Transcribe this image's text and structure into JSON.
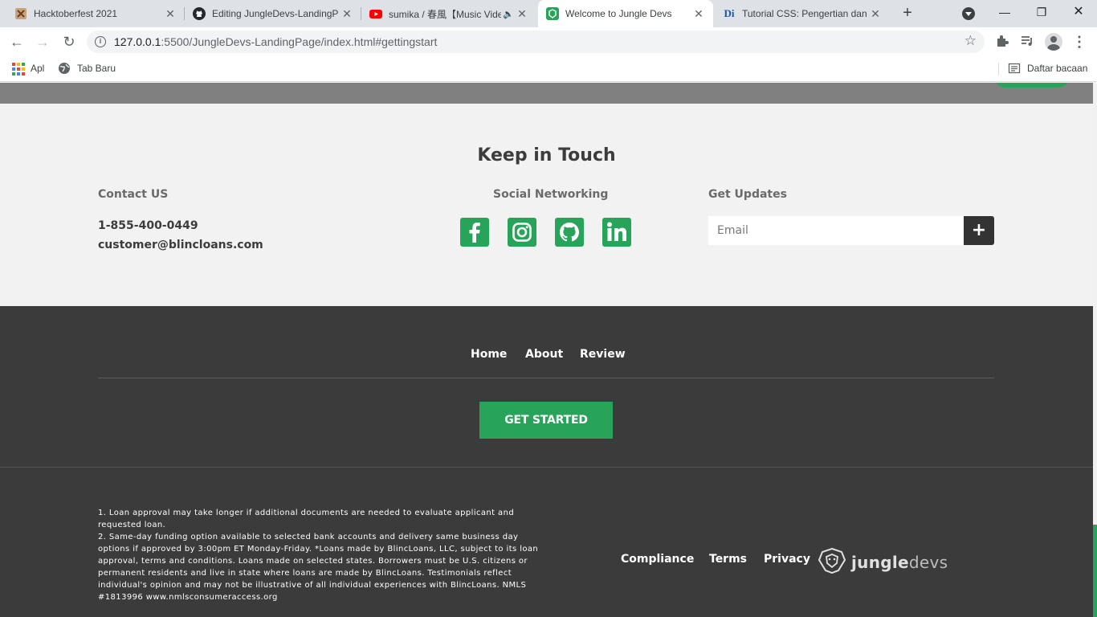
{
  "browser": {
    "tabs": [
      {
        "title": "Hacktoberfest 2021",
        "favicon": "hacktoberfest-icon"
      },
      {
        "title": "Editing JungleDevs-LandingP",
        "favicon": "github-icon"
      },
      {
        "title": "sumika / 春風【Music Vide",
        "favicon": "youtube-icon"
      },
      {
        "title": "Welcome to Jungle Devs",
        "favicon": "jungledevs-icon",
        "active": true
      },
      {
        "title": "Tutorial CSS: Pengertian dan",
        "favicon": "dicoding-icon",
        "favicon_text": "Di"
      }
    ],
    "url": {
      "host": "127.0.0.1",
      "path": ":5500/JungleDevs-LandingPage/index.html#gettingstart"
    },
    "bookmarks": [
      {
        "label": "Apl"
      },
      {
        "label": "Tab Baru"
      }
    ],
    "reading_list": "Daftar bacaan"
  },
  "contact": {
    "title": "Keep in Touch",
    "contact_heading": "Contact US",
    "phone": "1-855-400-0449",
    "email": "customer@blincloans.com",
    "social_heading": "Social Networking",
    "social": [
      "facebook-icon",
      "instagram-icon",
      "github-icon",
      "linkedin-icon"
    ],
    "updates_heading": "Get Updates",
    "email_placeholder": "Email",
    "submit_label": "+"
  },
  "footer": {
    "nav": [
      "Home",
      "About",
      "Review"
    ],
    "cta": "GET STARTED",
    "disclaimer_1": "1. Loan approval may take longer if additional documents are needed to evaluate applicant and requested loan.",
    "disclaimer_2": "2. Same-day funding option available to selected bank accounts and delivery same business day options if approved by 3:00pm ET Monday-Friday. *Loans made by BlincLoans, LLC, subject to its loan approval, terms and conditions. Loans made on selected states. Borrowers must be U.S. citizens or permanent residents and live in state where loans are made by BlincLoans. Testimonials reflect individual's opinion and may not be illustrative of all individual experiences with BlincLoans. NMLS #1813996 www.nmlsconsumeraccess.org",
    "links": [
      "Compliance",
      "Terms",
      "Privacy"
    ],
    "logo_text_bold": "jungle",
    "logo_text_light": "devs"
  },
  "colors": {
    "brand_green": "#27a35a",
    "footer_bg": "#3b3b3b",
    "contact_bg": "#f2f2f2"
  }
}
